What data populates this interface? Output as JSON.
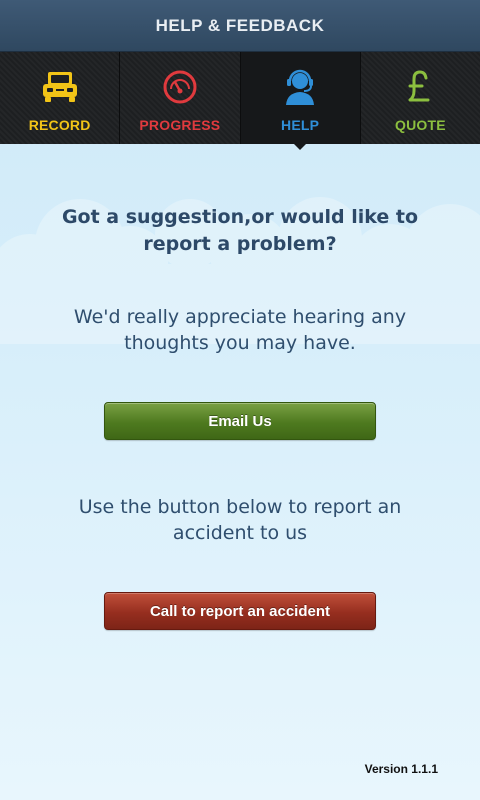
{
  "header": {
    "title": "HELP & FEEDBACK"
  },
  "tabs": [
    {
      "label": "RECORD",
      "icon": "car-icon",
      "color": "#f2c417"
    },
    {
      "label": "PROGRESS",
      "icon": "speedometer-icon",
      "color": "#e03a3e"
    },
    {
      "label": "HELP",
      "icon": "support-agent-icon",
      "color": "#2f8fd8",
      "active": true
    },
    {
      "label": "QUOTE",
      "icon": "pound-icon",
      "color": "#8cbf3f"
    }
  ],
  "main": {
    "heading": "Got a suggestion,or would like to report a problem?",
    "intro": "We'd really appreciate hearing any thoughts you may have.",
    "email_button": "Email Us",
    "accident_text": "Use the button below to report an accident to us",
    "call_button": "Call to report an accident"
  },
  "footer": {
    "version": "Version 1.1.1"
  }
}
